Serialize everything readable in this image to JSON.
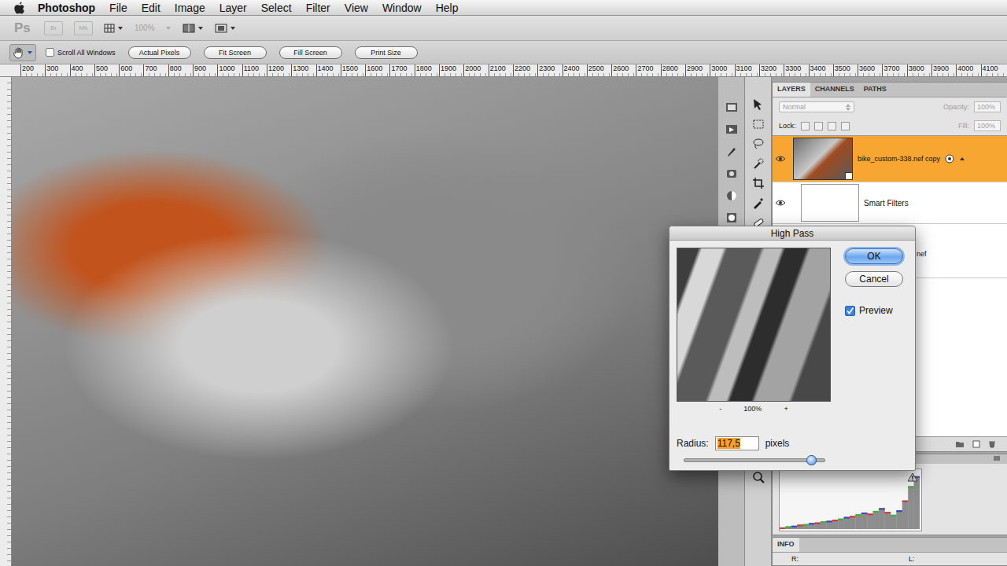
{
  "menubar": {
    "app_name": "Photoshop",
    "menus": [
      "File",
      "Edit",
      "Image",
      "Layer",
      "Select",
      "Filter",
      "View",
      "Window",
      "Help"
    ]
  },
  "app_bar": {
    "logo": "Ps",
    "launchers": [
      "Br",
      "Mb"
    ],
    "zoom": {
      "value": "100%",
      "disabled": true
    }
  },
  "options_bar": {
    "scroll_all_windows": {
      "label": "Scroll All Windows",
      "checked": false
    },
    "buttons": [
      "Actual Pixels",
      "Fit Screen",
      "Fill Screen",
      "Print Size"
    ]
  },
  "ruler": {
    "ticks": [
      "200",
      "300",
      "400",
      "500",
      "600",
      "700",
      "800",
      "900",
      "1000",
      "1100",
      "1200",
      "1300",
      "1400",
      "1500",
      "1600",
      "1700",
      "1800",
      "1900",
      "2000",
      "2100",
      "2200",
      "2300",
      "2400",
      "2500",
      "2600",
      "2700",
      "2800",
      "2900",
      "3000",
      "3100",
      "3200",
      "3300",
      "3400",
      "3500",
      "3600",
      "3700",
      "3800",
      "3900",
      "4000",
      "4100"
    ]
  },
  "layers_panel": {
    "tabs": [
      {
        "label": "LAYERS",
        "selected": true
      },
      {
        "label": "CHANNELS",
        "selected": false
      },
      {
        "label": "PATHS",
        "selected": false
      }
    ],
    "blend_mode": {
      "value": "Normal",
      "disabled": true
    },
    "opacity": {
      "label": "Opacity:",
      "value": "100%",
      "disabled": true
    },
    "lock_label": "Lock:",
    "fill": {
      "label": "Fill:",
      "value": "100%",
      "disabled": true
    },
    "layers": [
      {
        "name": "bike_custom-338.nef copy",
        "kind": "smart-object",
        "selected": true,
        "visible": true
      },
      {
        "name": "Smart Filters",
        "kind": "filter-mask",
        "selected": false,
        "visible": true
      },
      {
        "name": "nef",
        "kind": "layer",
        "selected": false,
        "visible": true
      }
    ]
  },
  "histogram": {
    "values": [
      3,
      5,
      6,
      8,
      9,
      11,
      12,
      14,
      15,
      17,
      19,
      22,
      24,
      27,
      30,
      28,
      33,
      38,
      31,
      26,
      34,
      52,
      78,
      96
    ]
  },
  "info_panel": {
    "tab": "INFO",
    "fields": [
      "R:",
      "L:"
    ]
  },
  "dialog": {
    "title": "High Pass",
    "zoom_out": "-",
    "zoom": "100%",
    "zoom_in": "+",
    "buttons": [
      {
        "label": "OK",
        "default": true
      },
      {
        "label": "Cancel",
        "default": false
      }
    ],
    "preview": {
      "label": "Preview",
      "checked": true
    },
    "radius_label": "Radius:",
    "radius": {
      "value": "117,5",
      "selected": true
    },
    "unit": "pixels",
    "slider": {
      "level": 0.91
    }
  }
}
